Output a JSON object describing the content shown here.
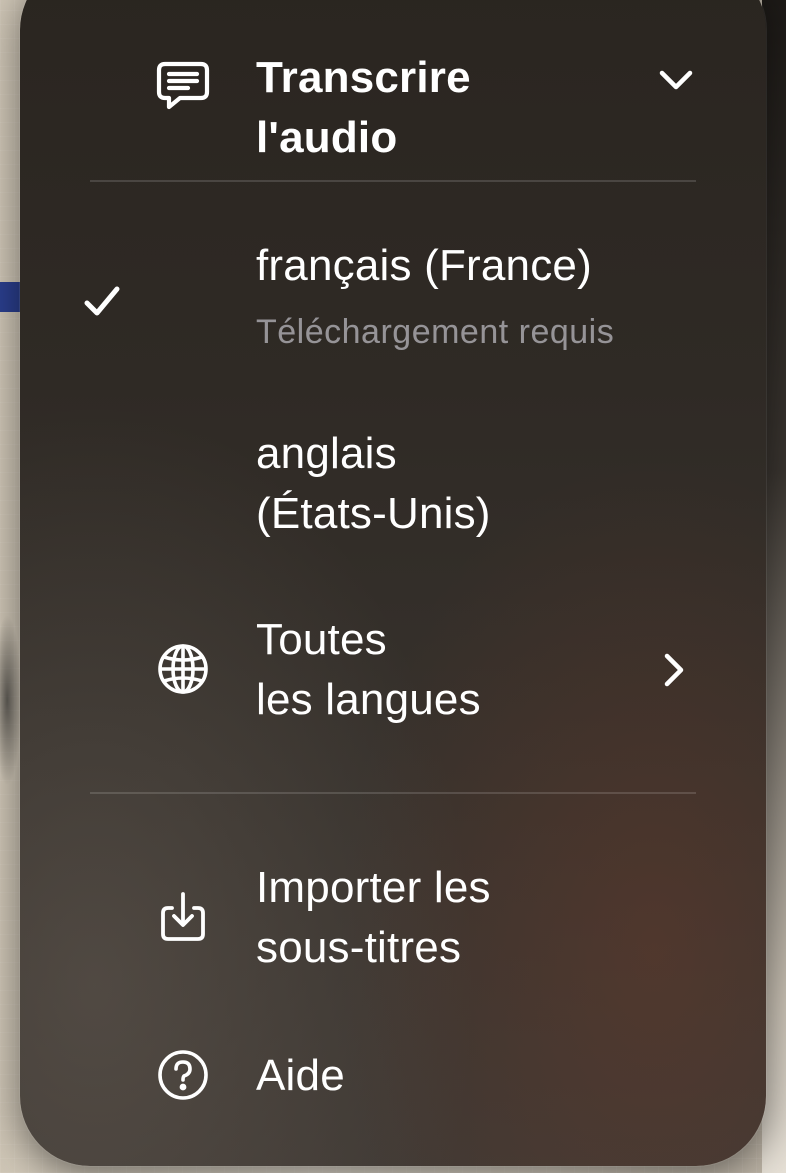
{
  "header": {
    "icon": "message-icon",
    "title_line1": "Transcrire",
    "title_line2": "l'audio",
    "chevron_icon": "chevron-down-icon"
  },
  "languages": [
    {
      "label": "français (France)",
      "subtitle": "Téléchargement requis",
      "selected": true
    },
    {
      "label_line1": "anglais",
      "label_line2": "(États-Unis)",
      "selected": false
    }
  ],
  "all_languages": {
    "icon": "globe-icon",
    "label_line1": "Toutes",
    "label_line2": "les langues",
    "chevron_icon": "chevron-right-icon"
  },
  "import_subtitles": {
    "icon": "import-icon",
    "label_line1": "Importer les",
    "label_line2": "sous-titres"
  },
  "help": {
    "icon": "help-icon",
    "label": "Aide"
  },
  "colors": {
    "menu_background": "#2f2a25",
    "text": "#ffffff",
    "secondary_text": "#9c9893",
    "separator": "#4a4540"
  }
}
